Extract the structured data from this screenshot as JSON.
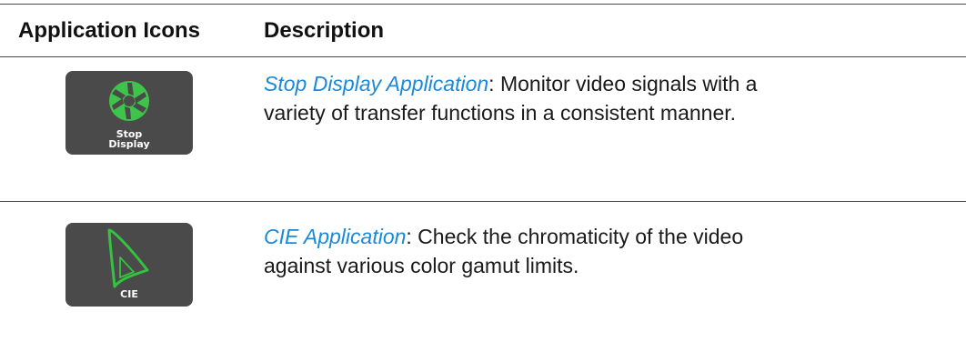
{
  "header": {
    "col1": "Application Icons",
    "col2": "Description"
  },
  "rows": [
    {
      "icon_name": "aperture-icon",
      "icon_label_line1": "Stop",
      "icon_label_line2": "Display",
      "icon_color": "#3fc34a",
      "link_text": "Stop Display Application",
      "description": ": Monitor video signals with a variety of transfer functions in a consistent manner."
    },
    {
      "icon_name": "cie-triangle-icon",
      "icon_label_line1": "CIE",
      "icon_color": "#34c240",
      "link_text": "CIE Application",
      "description": ": Check the chromaticity of the video against various color gamut limits."
    }
  ],
  "colors": {
    "link": "#1a8ad8",
    "icon_bg": "#4a4a4a",
    "rule": "#4a4a4a"
  }
}
